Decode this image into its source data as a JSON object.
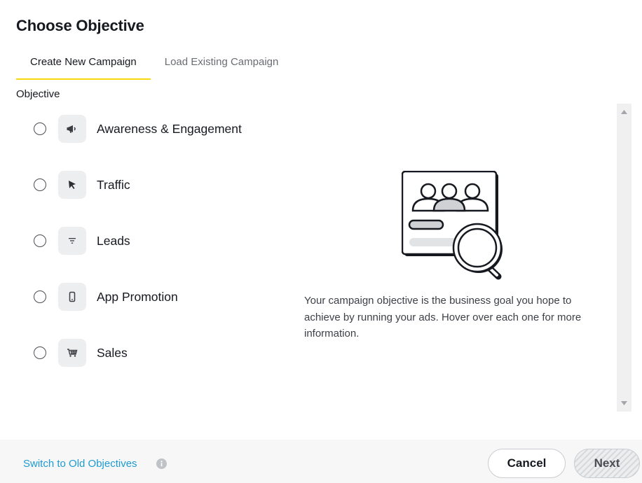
{
  "dialog": {
    "title": "Choose Objective"
  },
  "tabs": [
    {
      "label": "Create New Campaign",
      "active": true
    },
    {
      "label": "Load Existing Campaign",
      "active": false
    }
  ],
  "objective_section": {
    "label": "Objective",
    "options": [
      {
        "label": "Awareness & Engagement",
        "icon": "megaphone-icon",
        "selected": false
      },
      {
        "label": "Traffic",
        "icon": "cursor-icon",
        "selected": false
      },
      {
        "label": "Leads",
        "icon": "filter-icon",
        "selected": false
      },
      {
        "label": "App Promotion",
        "icon": "phone-icon",
        "selected": false
      },
      {
        "label": "Sales",
        "icon": "cart-icon",
        "selected": false
      }
    ],
    "description": "Your campaign objective is the business goal you hope to achieve by running your ads. Hover over each one for more information."
  },
  "footer": {
    "switch_link": "Switch to Old Objectives",
    "cancel_label": "Cancel",
    "next_label": "Next"
  },
  "colors": {
    "accent_yellow": "#f7d80a",
    "link_blue": "#1d9bd1",
    "icon_bg": "#eceef0"
  }
}
